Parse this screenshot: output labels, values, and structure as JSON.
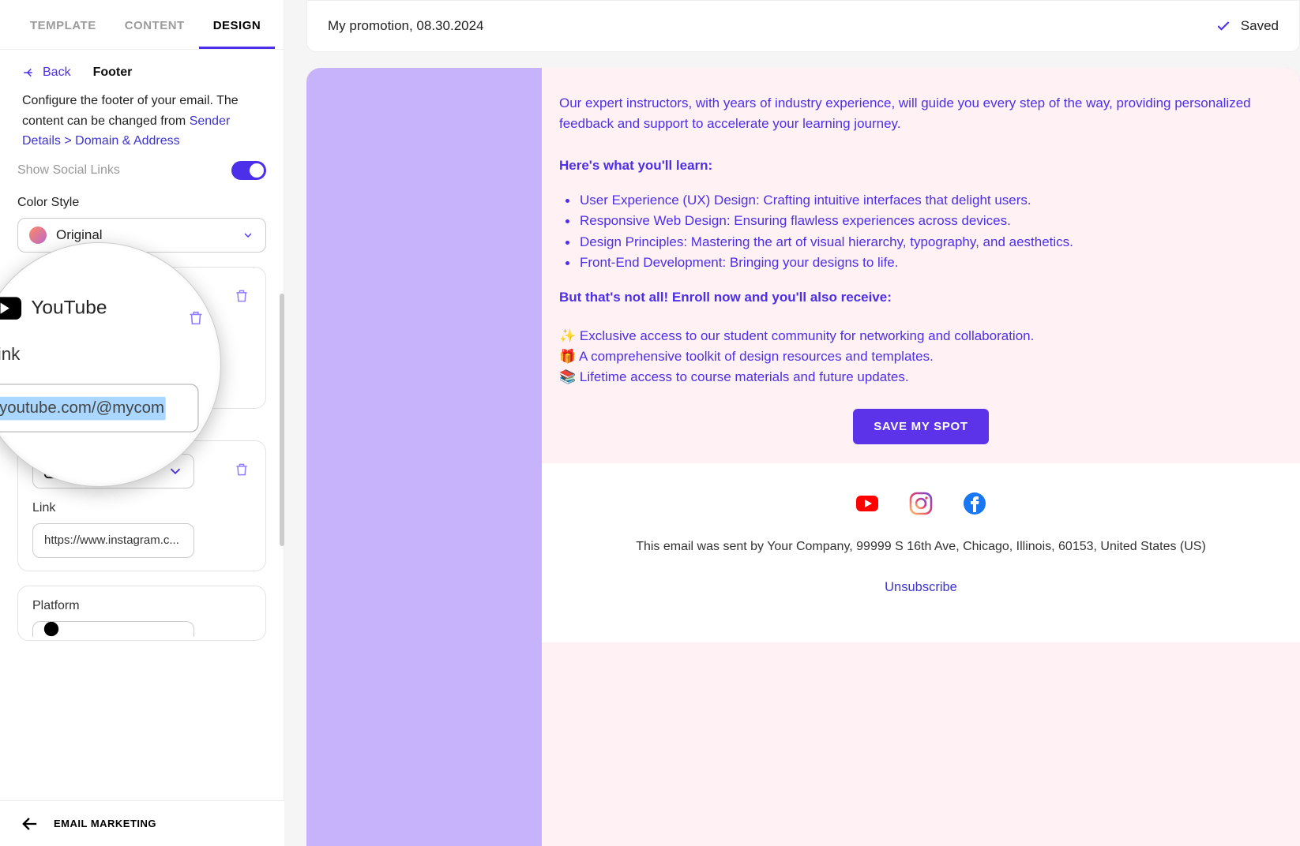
{
  "tabs": {
    "template": "TEMPLATE",
    "content": "CONTENT",
    "design": "DESIGN"
  },
  "subheader": {
    "back": "Back",
    "title": "Footer"
  },
  "description": {
    "text": "Configure the footer of your email. The content can be changed from ",
    "link": "Sender Details > Domain & Address"
  },
  "controls": {
    "showSocial": "Show Social Links",
    "colorStyleLabel": "Color Style",
    "colorStyleValue": "Original",
    "platformLabel": "Platform",
    "linkLabel": "Link"
  },
  "socialCards": {
    "instagramValue": "https://www.instagram.c..."
  },
  "magnifier": {
    "platform": "YouTube",
    "linkLabel": "Link",
    "value": ".youtube.com/@mycom"
  },
  "topbar": {
    "title": "My promotion, 08.30.2024",
    "saved": "Saved"
  },
  "email": {
    "intro": "Our expert instructors, with years of industry experience, will guide you every step of the way, providing personalized feedback and support to accelerate your learning journey.",
    "learnHeader": "Here's what you'll learn:",
    "bullets": [
      "User Experience (UX) Design: Crafting intuitive interfaces that delight users.",
      "Responsive Web Design: Ensuring flawless experiences across devices.",
      "Design Principles: Mastering the art of visual hierarchy, typography, and aesthetics.",
      "Front-End Development: Bringing your designs to life."
    ],
    "butHeader": "But that's not all! Enroll now and you'll also receive:",
    "extras": [
      "✨ Exclusive access to our student community for networking and collaboration.",
      "🎁 A comprehensive toolkit of design resources and templates.",
      "📚 Lifetime access to course materials and future updates."
    ],
    "cta": "SAVE MY SPOT",
    "sentBy": "This email was sent by Your Company, 99999 S 16th Ave, Chicago, Illinois, 60153, United States (US)",
    "unsubscribe": "Unsubscribe"
  },
  "bottomBar": "EMAIL MARKETING"
}
